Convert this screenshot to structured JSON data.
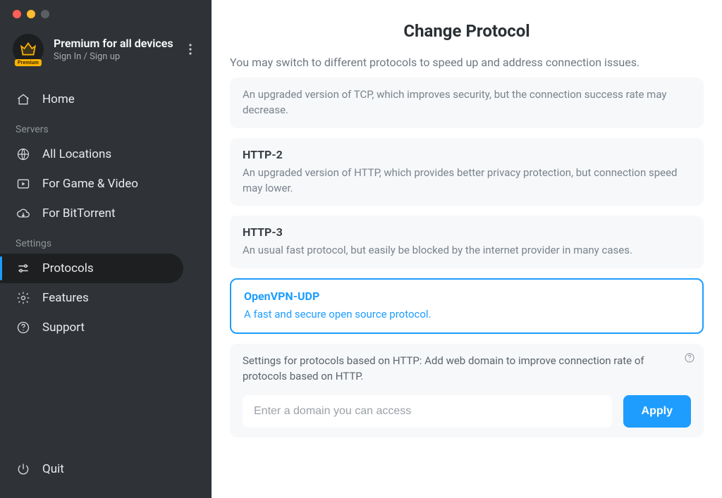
{
  "account": {
    "title": "Premium for all devices",
    "subtitle": "Sign In / Sign up",
    "badge": "Premium"
  },
  "sidebar": {
    "home": "Home",
    "servers_label": "Servers",
    "all_locations": "All Locations",
    "game_video": "For Game & Video",
    "bittorrent": "For BitTorrent",
    "settings_label": "Settings",
    "protocols": "Protocols",
    "features": "Features",
    "support": "Support",
    "quit": "Quit"
  },
  "main": {
    "title": "Change Protocol",
    "subtitle": "You may switch to different protocols to speed up and address connection issues.",
    "protocols": [
      {
        "title": "",
        "desc": "An upgraded version of TCP, which improves security, but the connection success rate may decrease."
      },
      {
        "title": "HTTP-2",
        "desc": "An upgraded version of HTTP, which provides better privacy protection, but connection speed may lower."
      },
      {
        "title": "HTTP-3",
        "desc": "An usual fast protocol, but easily be blocked by the internet provider in many cases."
      },
      {
        "title": "OpenVPN-UDP",
        "desc": "A fast and secure open source protocol."
      }
    ],
    "domain_hint": "Settings for protocols based on HTTP: Add web domain to improve connection rate of protocols based on HTTP.",
    "domain_placeholder": "Enter a domain you can access",
    "apply": "Apply"
  }
}
